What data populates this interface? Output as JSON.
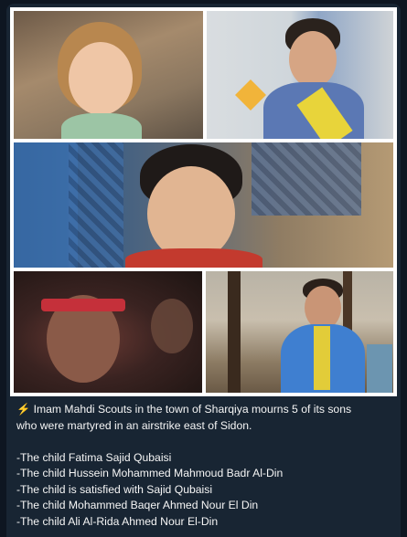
{
  "post": {
    "headline_icon": "lightning-emoji",
    "headline_icon_glyph": "⚡",
    "headline_line1": " Imam Mahdi Scouts in the town of Sharqiya mourns 5 of its sons",
    "headline_line2": "who were martyred in an airstrike east of Sidon.",
    "names": [
      "-The child Fatima Sajid Qubaisi",
      "-The child Hussein Mohammed Mahmoud Badr Al-Din",
      "-The child is satisfied with Sajid Qubaisi",
      "-The child Mohammed Baqer Ahmed Nour El Din",
      "-The child Ali Al-Rida Ahmed Nour El-Din"
    ]
  },
  "colors": {
    "background": "#0e1621",
    "bubble": "#182533",
    "text": "#f5f5f5"
  }
}
